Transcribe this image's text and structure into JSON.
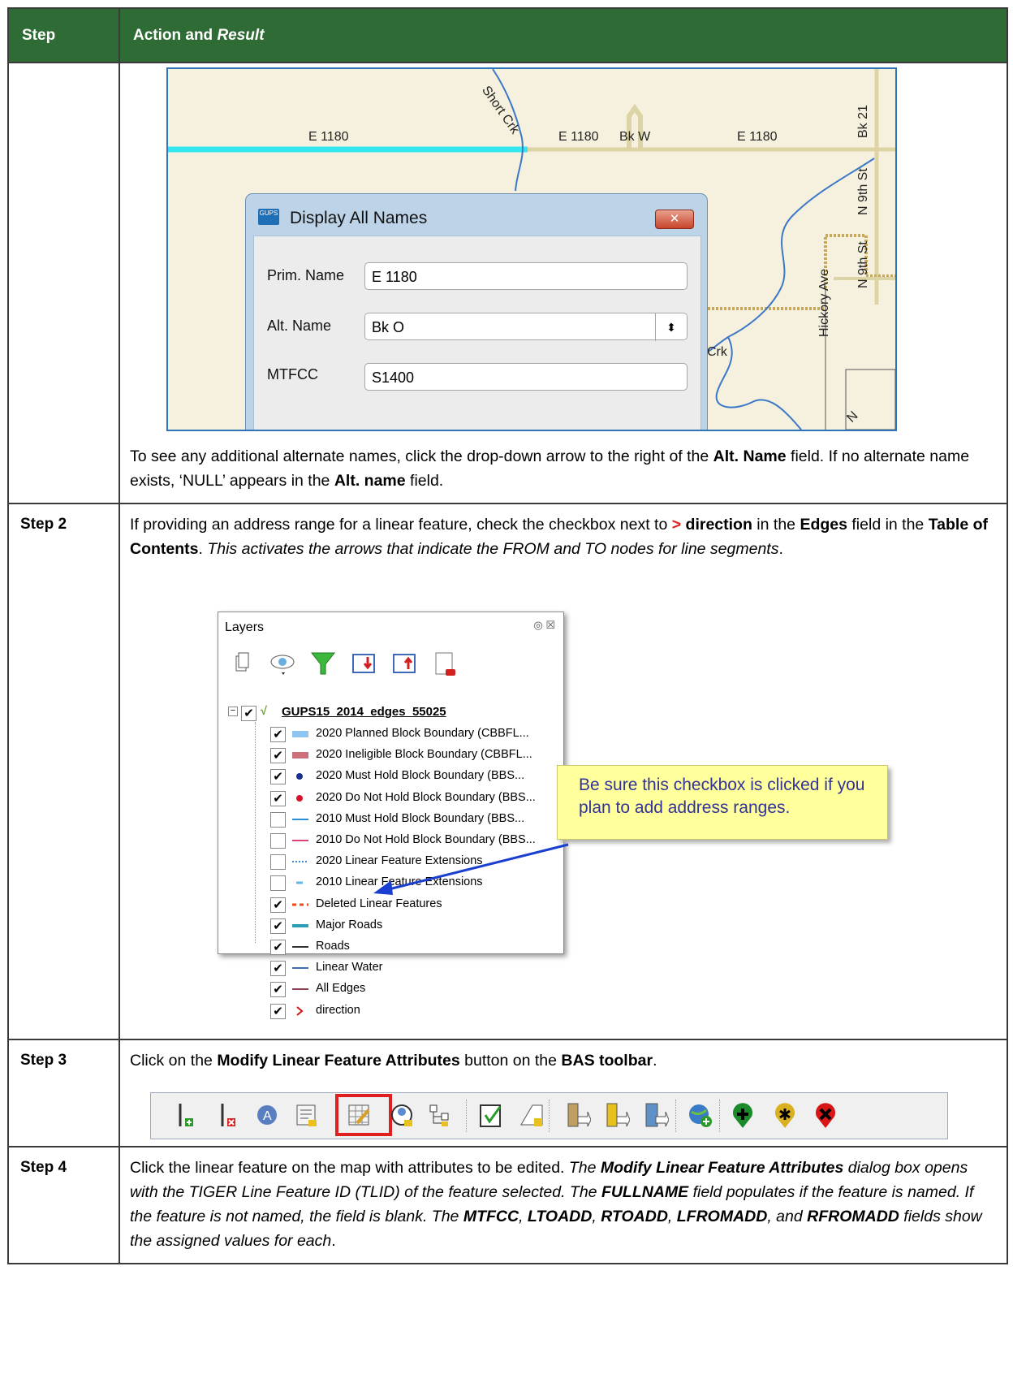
{
  "table": {
    "header": {
      "col1": "Step",
      "col2_main": "Action and ",
      "col2_italic": "Result"
    }
  },
  "map": {
    "road_labels": [
      "E 1180",
      "E 1180",
      "Bk W",
      "E 1180"
    ],
    "other_labels": [
      "Short Crk",
      "Bk 21",
      "N 9th St",
      "N 9th St",
      "Hickory Ave",
      "Crk",
      "N"
    ],
    "dialog": {
      "icon_text": "GUPS",
      "title": "Display All Names",
      "close_glyph": "✕",
      "fields": [
        {
          "label": "Prim. Name",
          "value": "E 1180"
        },
        {
          "label": "Alt. Name",
          "value": "Bk O"
        },
        {
          "label": "MTFCC",
          "value": "S1400"
        }
      ],
      "spinner_glyph": "⬍"
    }
  },
  "row1_text": {
    "a": "To see any additional alternate names, click the drop-down arrow to the right of the ",
    "b": "Alt. Name",
    "c": " field. If no alternate name exists, ‘NULL’ appears in the ",
    "d": "Alt. name",
    "e": " field."
  },
  "step2": {
    "label": "Step 2",
    "t1": "If providing an address range for a linear feature, check the checkbox next to ",
    "t2": ">",
    "t3": " direction",
    "t4": " in the ",
    "t5": "Edges",
    "t6": " field in the ",
    "t7": "Table of Contents",
    "t8": ". ",
    "t9": "This activates the arrows that indicate the FROM and TO nodes for line segments",
    "t10": "."
  },
  "layers": {
    "title": "Layers",
    "buttons": "◎ ☒",
    "group": "GUPS15_2014_edges_55025",
    "items": [
      {
        "label": "2020 Planned Block Boundary    (CBBFL...",
        "checked": true,
        "sym": "rect",
        "color": "#8ec4f0"
      },
      {
        "label": "2020 Ineligible Block Boundary  (CBBFL...",
        "checked": true,
        "sym": "rect",
        "color": "#cd6f7a"
      },
      {
        "label": "2020 Must Hold Block Boundary    (BBS...",
        "checked": true,
        "sym": "dot",
        "color": "#1a2f8f"
      },
      {
        "label": "2020 Do Not Hold Block Boundary (BBS...",
        "checked": true,
        "sym": "dot",
        "color": "#d8102a"
      },
      {
        "label": "2010 Must Hold Block Boundary    (BBS...",
        "checked": false,
        "sym": "line",
        "color": "#2a8fd8"
      },
      {
        "label": "2010 Do Not Hold Block Boundary (BBS...",
        "checked": false,
        "sym": "line",
        "color": "#e0407a"
      },
      {
        "label": "2020 Linear Feature Extensions",
        "checked": false,
        "sym": "dots",
        "color": "#3a8ad8"
      },
      {
        "label": "2010 Linear Feature Extensions",
        "checked": false,
        "sym": "dash",
        "color": "#60b8e8"
      },
      {
        "label": "Deleted Linear Features",
        "checked": true,
        "sym": "redash",
        "color": "#e84a1a"
      },
      {
        "label": "Major Roads",
        "checked": true,
        "sym": "thick",
        "color": "#2b9eb6"
      },
      {
        "label": "Roads",
        "checked": true,
        "sym": "line",
        "color": "#333333"
      },
      {
        "label": "Linear Water",
        "checked": true,
        "sym": "line",
        "color": "#3f6fb0"
      },
      {
        "label": "All Edges",
        "checked": true,
        "sym": "line",
        "color": "#8a4050"
      },
      {
        "label": "direction",
        "checked": true,
        "sym": "arrow",
        "color": "#c81818"
      }
    ],
    "check_glyph": "✔",
    "callout": "Be sure this checkbox is clicked if you plan to add address ranges."
  },
  "step3": {
    "label": "Step 3",
    "t1": "Click on the ",
    "t2": "Modify Linear Feature Attributes",
    "t3": " button on the ",
    "t4": "BAS toolbar",
    "t5": "."
  },
  "toolbar_icons": [
    "add-linear-feature-icon",
    "delete-linear-feature-icon",
    "address-icon",
    "attribute-table-icon",
    "modify-linear-attributes-icon",
    "user-icon",
    "hierarchy-icon",
    "checkbox-icon",
    "edit-shape-icon",
    "import-icon",
    "export-icon",
    "transfer-icon",
    "add-globe-icon",
    "add-point-icon",
    "star-point-icon",
    "delete-point-icon"
  ],
  "step4": {
    "label": "Step 4",
    "t1": "Click the linear feature on the map with attributes to be edited. ",
    "t2": "The ",
    "t3": "Modify Linear Feature Attributes",
    "t4": " dialog box opens with the TIGER Line Feature ID (TLID) of the feature selected. The ",
    "t5": "FULLNAME",
    "t6": " field populates if the feature is named. If the feature is not named, the field is blank. The ",
    "t7": "MTFCC",
    "t8": ", ",
    "t9": "LTOADD",
    "t10": ", ",
    "t11": "RTOADD",
    "t12": ", ",
    "t13": "LFROMADD",
    "t14": ", and ",
    "t15": "RFROMADD",
    "t16": " fields show the assigned values for each",
    "t17": "."
  },
  "colors": {
    "header_bg": "#2f6b35",
    "accent_red": "#e02020",
    "callout_text": "#333399",
    "callout_bg": "#ffff9c"
  }
}
